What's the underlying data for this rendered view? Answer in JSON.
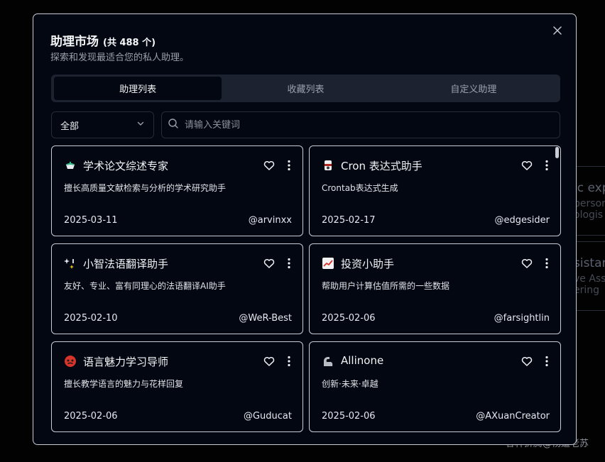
{
  "background": {
    "cards": [
      {
        "title": "ic exp",
        "desc": "persor\nologis"
      },
      {
        "title": "sistan",
        "desc": "ve Ass\nering"
      }
    ],
    "watermark": "各种折腾@杨道老苏"
  },
  "modal": {
    "title": "助理市场",
    "count": "(共 488 个)",
    "subtitle": "探索和发现最适合您的私人助理。",
    "close_icon": "close-icon"
  },
  "tabs": [
    {
      "label": "助理列表",
      "active": true
    },
    {
      "label": "收藏列表",
      "active": false
    },
    {
      "label": "自定义助理",
      "active": false
    }
  ],
  "filter": {
    "selected": "全部"
  },
  "search": {
    "placeholder": "请输入关键词",
    "value": ""
  },
  "cards": [
    {
      "emoji": "teapot",
      "name": "学术论文综述专家",
      "desc": "擅长高质量文献检索与分析的学术研究助手",
      "date": "2025-03-11",
      "author": "@arvinxx"
    },
    {
      "emoji": "clock-jar",
      "name": "Cron 表达式助手",
      "desc": "Crontab表达式生成",
      "date": "2025-02-17",
      "author": "@edgesider"
    },
    {
      "emoji": "sparkle",
      "name": "小智法语翻译助手",
      "desc": "友好、专业、富有同理心的法语翻译AI助手",
      "date": "2025-02-10",
      "author": "@WeR-Best"
    },
    {
      "emoji": "chart-up",
      "name": "投资小助手",
      "desc": "帮助用户计算估值所需的一些数据",
      "date": "2025-02-06",
      "author": "@farsightlin"
    },
    {
      "emoji": "red-face",
      "name": "语言魅力学习导师",
      "desc": "擅长教学语言的魅力与花样回复",
      "date": "2025-02-06",
      "author": "@Guducat"
    },
    {
      "emoji": "muscle",
      "name": "Allinone",
      "desc": "创新·未来·卓越",
      "date": "2025-02-06",
      "author": "@AXuanCreator"
    }
  ]
}
